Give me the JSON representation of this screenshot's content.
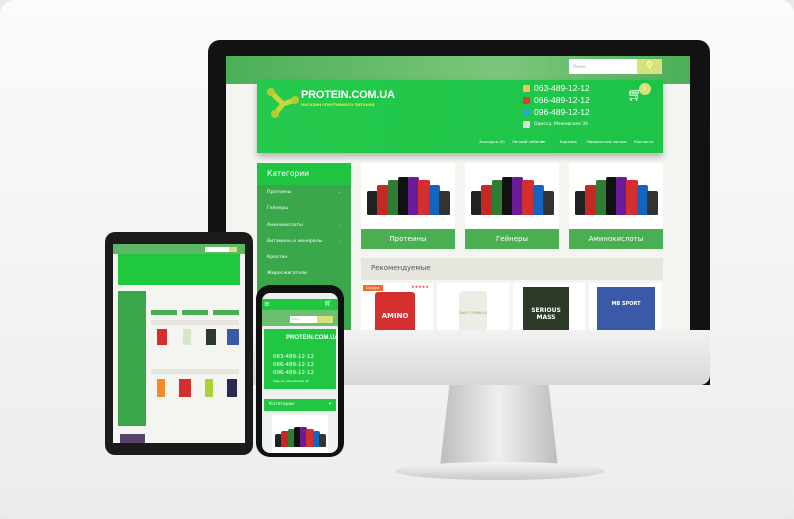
{
  "site": {
    "logo_title": "PROTEIN.COM.UA",
    "logo_subtitle": "МАГАЗИН СПОРТИВНОГО ПИТАНИЯ",
    "search_placeholder": "Поиск",
    "phones": [
      "063-489-12-12",
      "066-489-12-12",
      "096-489-12-12"
    ],
    "address": "Одесса, Межевская 30",
    "cart_count": "0",
    "nav": [
      "Закладки (0)",
      "Личный кабинет",
      "Корзина",
      "Оформление заказа",
      "Контакты"
    ],
    "sidebar": {
      "title": "Категории",
      "items": [
        {
          "label": "Протеины",
          "has_children": true
        },
        {
          "label": "Гейнеры",
          "has_children": false
        },
        {
          "label": "Аминокислоты",
          "has_children": true
        },
        {
          "label": "Витамины и минералы",
          "has_children": true
        },
        {
          "label": "Креатин",
          "has_children": false
        },
        {
          "label": "Жиросжигатели",
          "has_children": false
        }
      ]
    },
    "categories": [
      "Протеины",
      "Гейнеры",
      "Аминокислоты"
    ],
    "recommended_title": "Рекомендуемые",
    "sale_badge": "Скидка",
    "products": [
      "AMINO",
      "DAILY FORMULA",
      "SERIOUS MASS",
      "MB SPORT"
    ]
  },
  "colors": {
    "brand_green": "#22c94a",
    "sidebar_green": "#3aa84a",
    "accent_yellow": "#d6e37a"
  }
}
